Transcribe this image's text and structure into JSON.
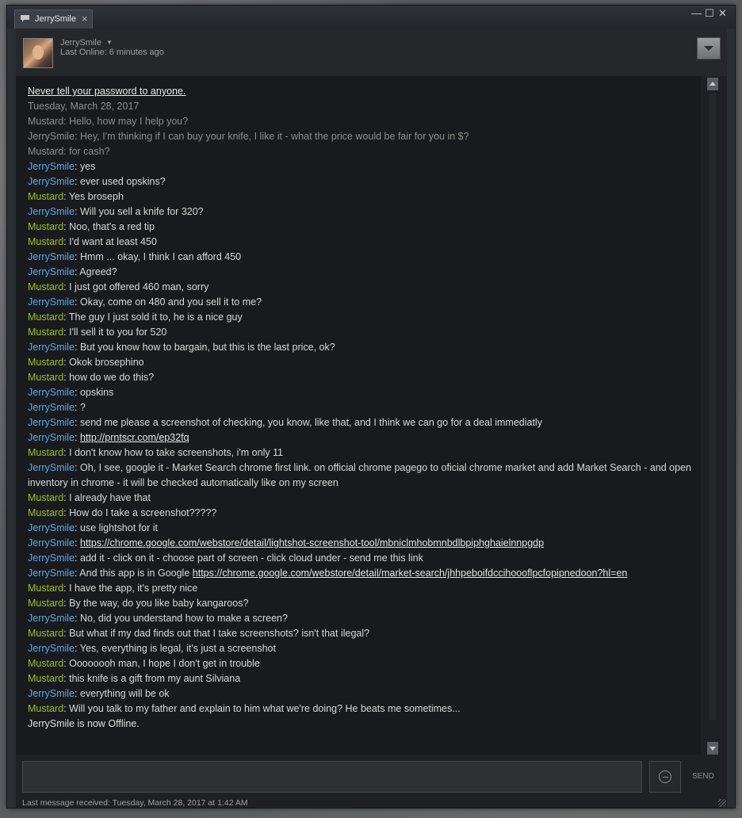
{
  "tab": {
    "label": "JerrySmile",
    "icon": "chat-bubble-icon"
  },
  "window_controls": {
    "minimize": "—",
    "maximize": "☐",
    "close": "✕"
  },
  "header": {
    "name": "JerrySmile",
    "status": "Last Online: 6 minutes ago"
  },
  "chat": {
    "warning": "Never tell your password to anyone.",
    "date": "Tuesday, March 28, 2017",
    "old_messages": [
      {
        "speaker": "Mustard",
        "text": ": Hello, how may I help you?"
      },
      {
        "speaker": "JerrySmile",
        "text": ": Hey, I'm thinking if I can buy your knife, I like it - what the price would be fair for you in $?"
      },
      {
        "speaker": "Mustard",
        "text": ": for cash?"
      }
    ],
    "messages": [
      {
        "speaker": "JerrySmile",
        "text": ": yes"
      },
      {
        "speaker": "JerrySmile",
        "text": ": ever used opskins?"
      },
      {
        "speaker": "Mustard",
        "text": ": Yes broseph"
      },
      {
        "speaker": "JerrySmile",
        "text": ": Will you sell a knife for 320?"
      },
      {
        "speaker": "Mustard",
        "text": ": Noo, that's a red tip"
      },
      {
        "speaker": "Mustard",
        "text": ": I'd want at least 450"
      },
      {
        "speaker": "JerrySmile",
        "text": ": Hmm ... okay, I think I can afford 450"
      },
      {
        "speaker": "JerrySmile",
        "text": ": Agreed?"
      },
      {
        "speaker": "Mustard",
        "text": ": I just got offered 460 man, sorry"
      },
      {
        "speaker": "JerrySmile",
        "text": ": Okay, come on 480 and you sell it to me?"
      },
      {
        "speaker": "Mustard",
        "text": ": The guy I just sold it to, he is a nice guy"
      },
      {
        "speaker": "Mustard",
        "text": ": I'll sell it to you for 520"
      },
      {
        "speaker": "JerrySmile",
        "text": ": But you know how to bargain, but this is the last price, ok?"
      },
      {
        "speaker": "Mustard",
        "text": ": Okok brosephino"
      },
      {
        "speaker": "Mustard",
        "text": ": how do we do this?"
      },
      {
        "speaker": "JerrySmile",
        "text": ": opskins"
      },
      {
        "speaker": "JerrySmile",
        "text": ": ?"
      },
      {
        "speaker": "JerrySmile",
        "text": ": send me please a screenshot of checking, you know, like that, and I think we can go for a deal immediatly"
      },
      {
        "speaker": "JerrySmile",
        "text": ": ",
        "link": "http://prntscr.com/ep32fq"
      },
      {
        "speaker": "Mustard",
        "text": ": I don't know how to take screenshots, i'm only 11"
      },
      {
        "speaker": "JerrySmile",
        "text": ": Oh, I see,  google it - Market Search chrome first link. on official chrome pagego to oficial chrome market and add Market Search - and open inventory in chrome - it will be checked automatically like on my screen"
      },
      {
        "speaker": "Mustard",
        "text": ": I already have that"
      },
      {
        "speaker": "Mustard",
        "text": ": How do I take a screenshot?????"
      },
      {
        "speaker": "JerrySmile",
        "text": ": use lightshot for it"
      },
      {
        "speaker": "JerrySmile",
        "text": ": ",
        "link": "https://chrome.google.com/webstore/detail/lightshot-screenshot-tool/mbniclmhobmnbdlbpiphghaielnnpgdp"
      },
      {
        "speaker": "JerrySmile",
        "text": ": add it - click on it - choose part of screen - click cloud under - send me this link"
      },
      {
        "speaker": "JerrySmile",
        "text": ": And this app is in Google ",
        "link": "https://chrome.google.com/webstore/detail/market-search/jhhpeboifdccihoooflpcfopipnedoon?hl=en"
      },
      {
        "speaker": "Mustard",
        "text": ": I have the app, it's pretty nice"
      },
      {
        "speaker": "Mustard",
        "text": ": By the way, do you like baby kangaroos?"
      },
      {
        "speaker": "JerrySmile",
        "text": ": No, did you understand how to make a screen?"
      },
      {
        "speaker": "Mustard",
        "text": ": But what if my dad finds out that I take screenshots? isn't that ilegal?"
      },
      {
        "speaker": "JerrySmile",
        "text": ": Yes, everything is legal, it's just a screenshot"
      },
      {
        "speaker": "Mustard",
        "text": ": Oooooooh man, I hope I don't get in trouble"
      },
      {
        "speaker": "Mustard",
        "text": ": this knife is a gift from my aunt Silviana"
      },
      {
        "speaker": "JerrySmile",
        "text": ": everything will be ok"
      },
      {
        "speaker": "Mustard",
        "text": ": Will you talk to my father and explain to him what we're doing? He beats me sometimes..."
      }
    ],
    "status_line": "JerrySmile is now Offline."
  },
  "composer": {
    "placeholder": "",
    "send_label": "SEND",
    "emoticon_icon": "smiley-icon"
  },
  "footer": {
    "last_message": "Last message received: Tuesday, March 28, 2017 at 1:42 AM"
  },
  "colors": {
    "jerry": "#62a7e3",
    "mustard": "#9fbe2c",
    "old": "#8e8e8e",
    "window": "#2b2e33"
  }
}
